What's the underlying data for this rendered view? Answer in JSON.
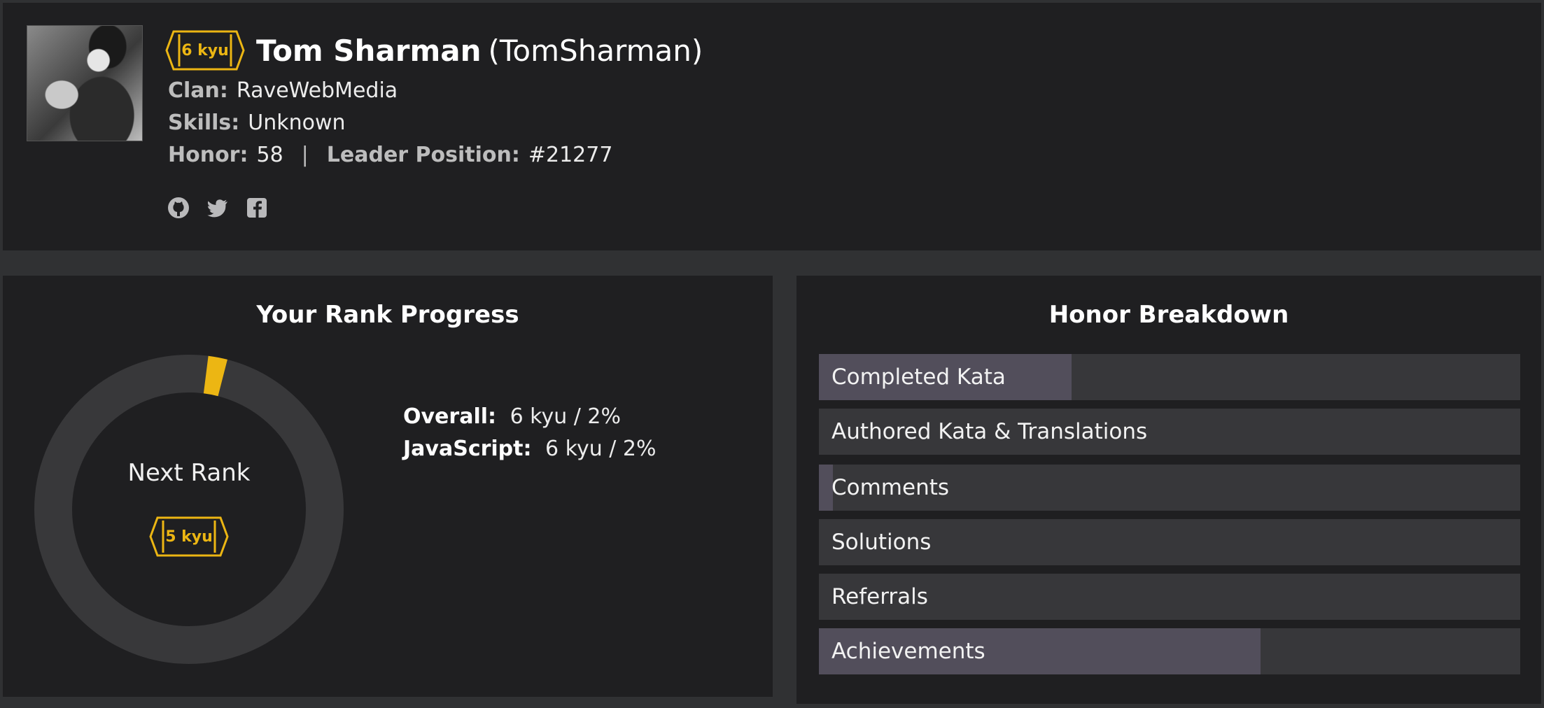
{
  "profile": {
    "rank": "6 kyu",
    "name": "Tom Sharman",
    "username": "(TomSharman)",
    "clan_label": "Clan:",
    "clan": "RaveWebMedia",
    "skills_label": "Skills:",
    "skills": "Unknown",
    "honor_label": "Honor:",
    "honor": "58",
    "separator": "|",
    "leader_label": "Leader Position:",
    "leader_position": "#21277",
    "social_icons": [
      "github-icon",
      "twitter-icon",
      "facebook-icon"
    ]
  },
  "rank_progress": {
    "title": "Your Rank Progress",
    "progress_fraction": 0.02,
    "next_rank_label": "Next Rank",
    "next_rank": "5 kyu",
    "overall_label": "Overall:",
    "overall_value": "6 kyu / 2%",
    "javascript_label": "JavaScript:",
    "javascript_value": "6 kyu / 2%"
  },
  "honor_breakdown": {
    "title": "Honor Breakdown",
    "items": [
      {
        "label": "Completed Kata",
        "fraction": 0.36
      },
      {
        "label": "Authored Kata & Translations",
        "fraction": 0.0
      },
      {
        "label": "Comments",
        "fraction": 0.02
      },
      {
        "label": "Solutions",
        "fraction": 0.0
      },
      {
        "label": "Referrals",
        "fraction": 0.0
      },
      {
        "label": "Achievements",
        "fraction": 0.63
      }
    ]
  },
  "colors": {
    "accent": "#ecb613",
    "panel": "#1f1f21",
    "background": "#303133",
    "bar_track": "#37373a",
    "bar_fill": "#524e5b",
    "donut_track": "#38383a"
  }
}
